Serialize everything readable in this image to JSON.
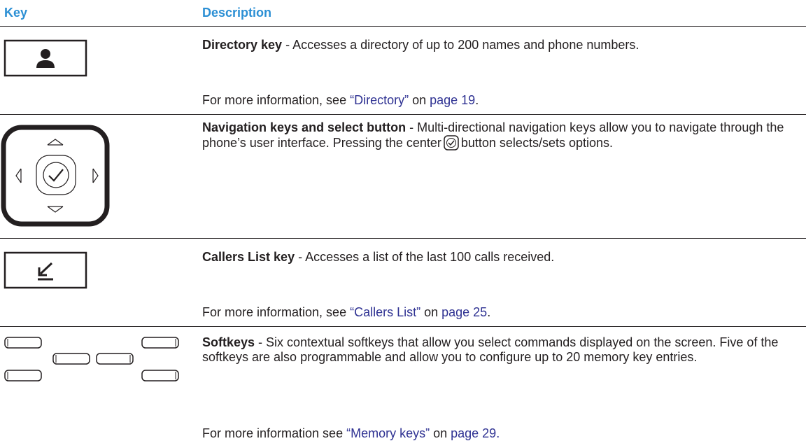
{
  "header": {
    "key": "Key",
    "description": "Description"
  },
  "rows": [
    {
      "icon": "person-icon",
      "title": "Directory key",
      "text": " - Accesses a directory of up to 200 names and phone numbers.",
      "more_prefix": "For more information, see ",
      "more_link": "“Directory”",
      "more_mid": " on ",
      "more_page": "page 19",
      "more_suffix": "."
    },
    {
      "icon": "navigation-pad-icon",
      "title": "Navigation keys and select button",
      "text_a": " - Multi-directional navigation keys allow you to navigate through the phone’s user interface. Pressing the center",
      "text_b": "button selects/sets options."
    },
    {
      "icon": "callers-list-icon",
      "title": "Callers List key",
      "text": " - Accesses a list of the last 100 calls received.",
      "more_prefix": "For more information, see ",
      "more_link": "“Callers List”",
      "more_mid": " on ",
      "more_page": "page 25",
      "more_suffix": "."
    },
    {
      "icon": "softkeys-icon",
      "title": "Softkeys",
      "text": " - Six contextual softkeys that allow you select commands displayed on the screen. Five of the softkeys are also programmable and allow you to configure up to 20 memory key entries.",
      "more_prefix": "For more information see ",
      "more_link": "“Memory keys”",
      "more_mid": " on ",
      "more_page": "page 29.",
      "more_suffix": ""
    }
  ]
}
